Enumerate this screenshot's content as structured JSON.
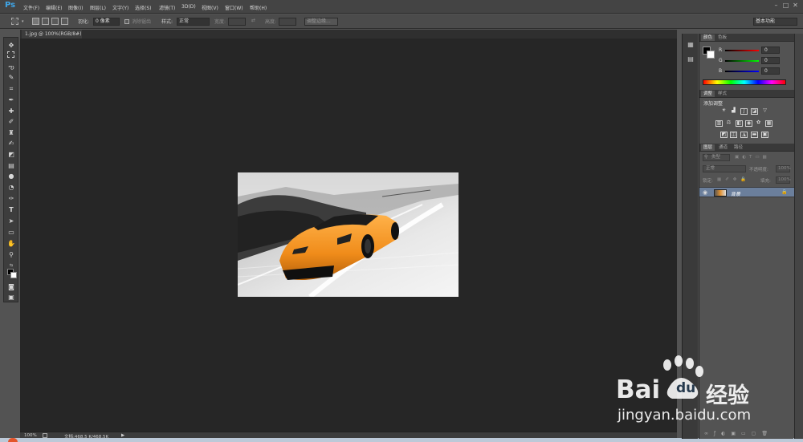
{
  "app": {
    "logo": "Ps"
  },
  "menu": [
    "文件(F)",
    "编辑(E)",
    "图像(I)",
    "图层(L)",
    "文字(Y)",
    "选择(S)",
    "滤镜(T)",
    "3D(D)",
    "视图(V)",
    "窗口(W)",
    "帮助(H)"
  ],
  "window_buttons": [
    "–",
    "□",
    "✕"
  ],
  "options": {
    "feather_label": "羽化:",
    "feather_value": "0 像素",
    "antialias_label": "消除锯齿",
    "style_label": "样式:",
    "style_value": "正常",
    "width_label": "宽度:",
    "height_label": "高度:",
    "refine_label": "调整边缘...",
    "workspace_value": "基本功能"
  },
  "document": {
    "tab_label": "1.jpg @ 100%(RGB/8#)"
  },
  "status": {
    "zoom": "100%",
    "doc_info": "文档:468.5 K/468.5K"
  },
  "tools": [
    "move-icon",
    "marquee-icon",
    "lasso-icon",
    "quick-select-icon",
    "crop-icon",
    "eyedropper-icon",
    "healing-icon",
    "brush-icon",
    "stamp-icon",
    "history-brush-icon",
    "eraser-icon",
    "gradient-icon",
    "blur-icon",
    "dodge-icon",
    "pen-icon",
    "type-icon",
    "path-select-icon",
    "shape-icon",
    "hand-icon",
    "zoom-icon"
  ],
  "color_panel": {
    "tabs": [
      "颜色",
      "色板"
    ],
    "channels": [
      {
        "label": "R",
        "value": "0",
        "gradient": "#ff0000"
      },
      {
        "label": "G",
        "value": "0",
        "gradient": "#00ff00"
      },
      {
        "label": "B",
        "value": "0",
        "gradient": "#0000ff"
      }
    ]
  },
  "adjust_panel": {
    "tabs": [
      "调整",
      "样式"
    ],
    "title": "添加调整"
  },
  "layers_panel": {
    "tabs": [
      "图层",
      "通道",
      "路径"
    ],
    "kind_label": "类型",
    "blend_value": "正常",
    "opacity_label": "不透明度:",
    "opacity_value": "100%",
    "lock_label": "锁定:",
    "fill_label": "填充:",
    "fill_value": "100%",
    "layer_name": "背景"
  },
  "watermark": {
    "brand_bai": "Bai",
    "brand_du": "du",
    "brand_cn": "经验",
    "url": "jingyan.baidu.com"
  }
}
